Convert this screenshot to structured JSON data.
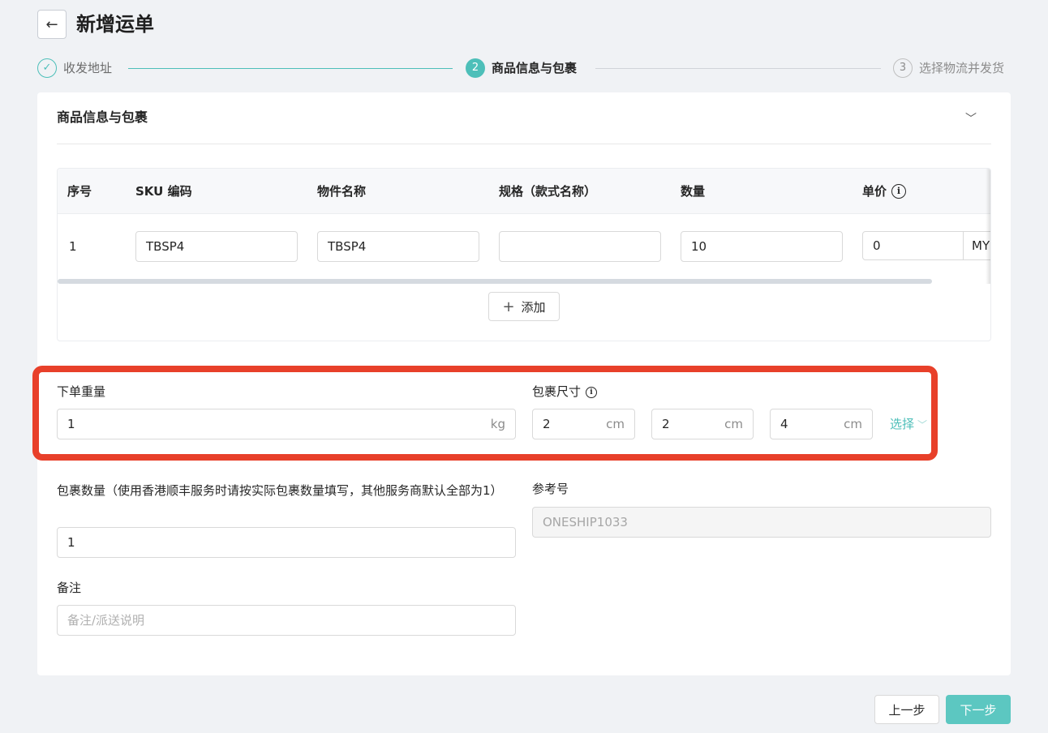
{
  "header": {
    "title": "新增运单",
    "back_icon": "arrow-left-icon"
  },
  "steps": [
    {
      "number": "✓",
      "label": "收发地址",
      "state": "done"
    },
    {
      "number": "2",
      "label": "商品信息与包裹",
      "state": "active"
    },
    {
      "number": "3",
      "label": "选择物流并发货",
      "state": "pending"
    }
  ],
  "section": {
    "title": "商品信息与包裹",
    "collapse_icon": "chevron-down-icon"
  },
  "table": {
    "columns": [
      "序号",
      "SKU 编码",
      "物件名称",
      "规格（款式名称）",
      "数量",
      "单价"
    ],
    "rows": [
      {
        "index": "1",
        "sku": "TBSP4",
        "name": "TBSP4",
        "spec": "",
        "qty": "10",
        "price": "0",
        "currency": "MY"
      }
    ],
    "add_label": "添加"
  },
  "form": {
    "weight": {
      "label": "下单重量",
      "value": "1",
      "unit": "kg"
    },
    "dimensions": {
      "label": "包裹尺寸",
      "length": "2",
      "width": "2",
      "height": "4",
      "unit": "cm",
      "select_label": "选择"
    },
    "package_count": {
      "label": "包裹数量（使用香港顺丰服务时请按实际包裹数量填写，其他服务商默认全部为1）",
      "value": "1"
    },
    "reference": {
      "label": "参考号",
      "value": "ONESHIP1033"
    },
    "remark": {
      "label": "备注",
      "placeholder": "备注/派送说明"
    }
  },
  "footer": {
    "prev_label": "上一步",
    "next_label": "下一步"
  },
  "colors": {
    "accent": "#4dbfb9",
    "highlight": "#e8402a"
  }
}
